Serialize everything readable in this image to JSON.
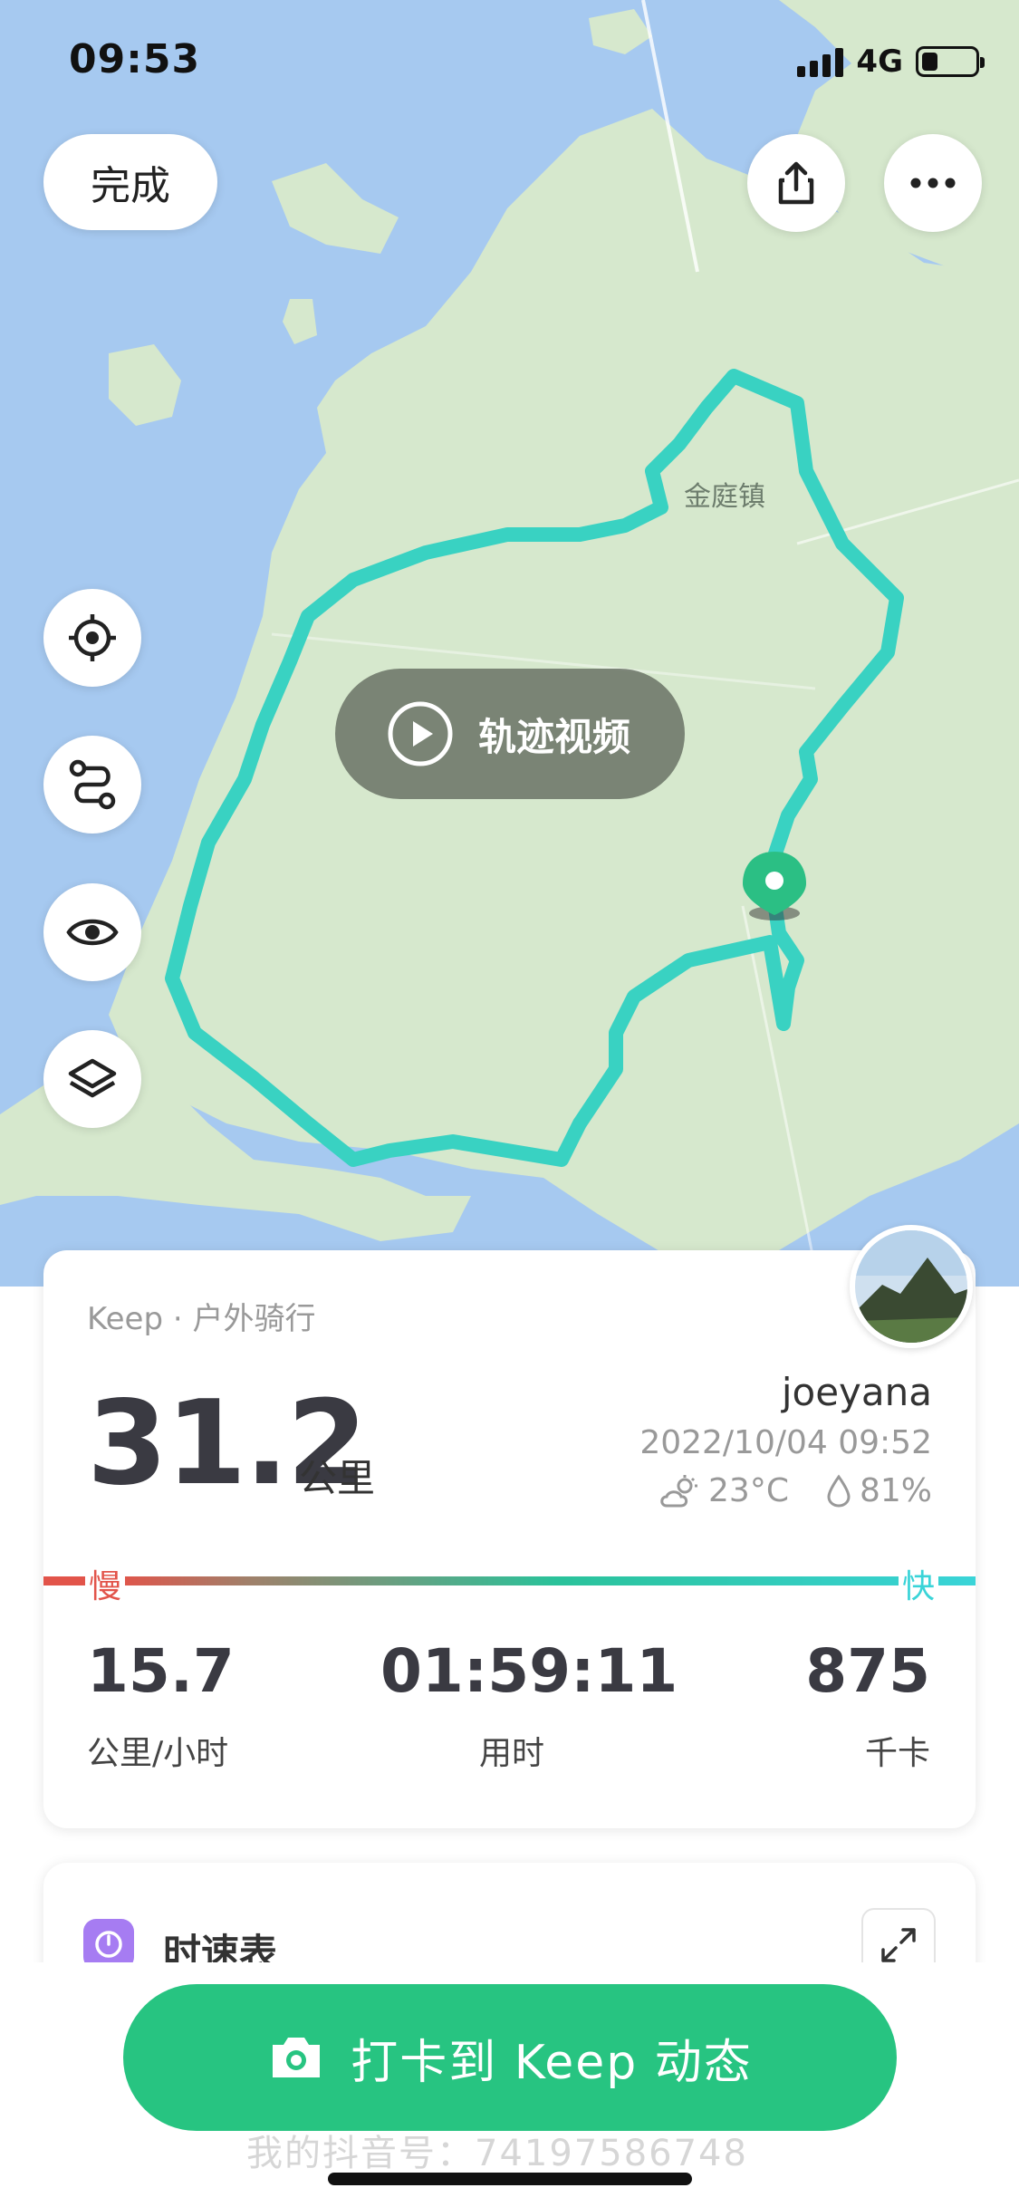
{
  "status_bar": {
    "time": "09:53",
    "network": "4G",
    "battery_level": 0.3
  },
  "top_bar": {
    "done_label": "完成",
    "share_icon": "share-icon",
    "more_icon": "more-icon"
  },
  "map": {
    "place_label": "金庭镇",
    "video_button_label": "轨迹视频",
    "side_controls": [
      "locate-icon",
      "route-icon",
      "eye-icon",
      "layers-icon"
    ],
    "colors": {
      "water": "#a6c9f0",
      "land": "#d6e8cd",
      "route": "#39d2c2",
      "marker": "#2bbf84"
    }
  },
  "summary": {
    "subtitle": "Keep · 户外骑行",
    "distance": "31.2",
    "distance_unit": "公里",
    "username": "joeyana",
    "datetime": "2022/10/04 09:52",
    "temperature": "23°C",
    "humidity": "81%",
    "slow_label": "慢",
    "fast_label": "快",
    "stats": [
      {
        "value": "15.7",
        "label": "公里/小时"
      },
      {
        "value": "01:59:11",
        "label": "用时"
      },
      {
        "value": "875",
        "label": "千卡"
      }
    ]
  },
  "speed_chart_card": {
    "title": "时速表"
  },
  "checkin": {
    "label": "打卡到 Keep 动态"
  },
  "watermark": "我的抖音号：74197586748"
}
